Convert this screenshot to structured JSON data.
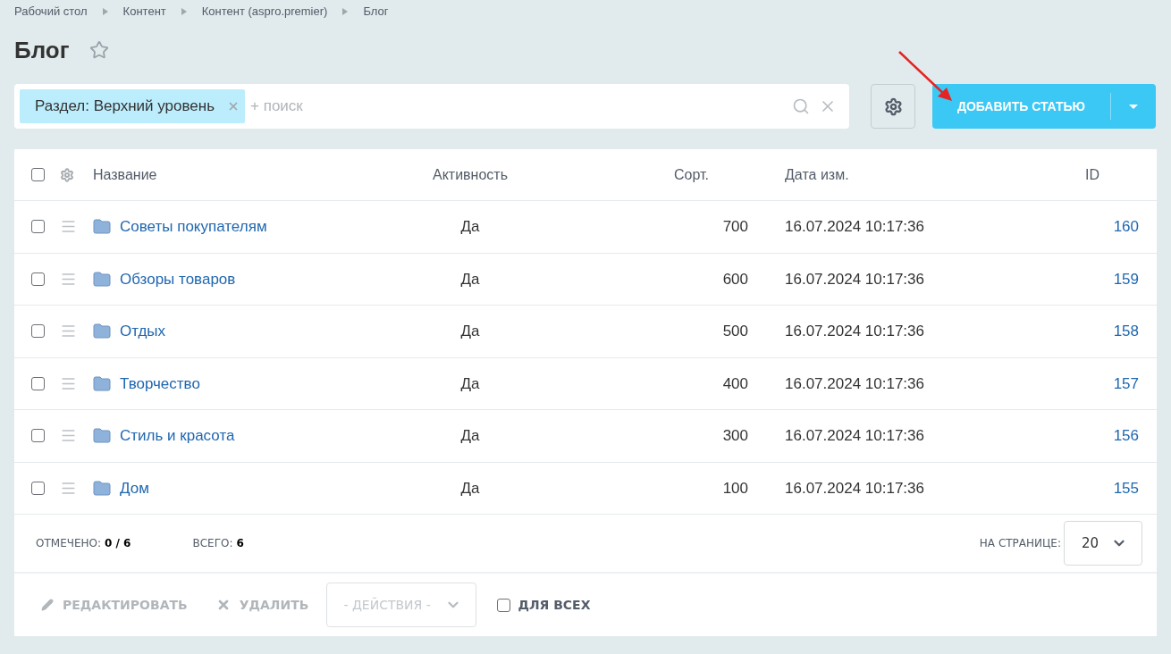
{
  "breadcrumbs": [
    "Рабочий стол",
    "Контент",
    "Контент (aspro.premier)",
    "Блог"
  ],
  "title": "Блог",
  "filter": {
    "tag": "Раздел: Верхний уровень",
    "placeholder": "+ поиск"
  },
  "add_button": {
    "label": "ДОБАВИТЬ СТАТЬЮ"
  },
  "table": {
    "select_all_checked": false,
    "columns": [
      "Название",
      "Активность",
      "Сорт.",
      "Дата изм.",
      "ID"
    ],
    "rows": [
      {
        "checked": false,
        "name": "Советы покупателям",
        "active": "Да",
        "sort": "700",
        "date": "16.07.2024 10:17:36",
        "id": "160"
      },
      {
        "checked": false,
        "name": "Обзоры товаров",
        "active": "Да",
        "sort": "600",
        "date": "16.07.2024 10:17:36",
        "id": "159"
      },
      {
        "checked": false,
        "name": "Отдых",
        "active": "Да",
        "sort": "500",
        "date": "16.07.2024 10:17:36",
        "id": "158"
      },
      {
        "checked": false,
        "name": "Творчество",
        "active": "Да",
        "sort": "400",
        "date": "16.07.2024 10:17:36",
        "id": "157"
      },
      {
        "checked": false,
        "name": "Стиль и красота",
        "active": "Да",
        "sort": "300",
        "date": "16.07.2024 10:17:36",
        "id": "156"
      },
      {
        "checked": false,
        "name": "Дом",
        "active": "Да",
        "sort": "100",
        "date": "16.07.2024 10:17:36",
        "id": "155"
      }
    ]
  },
  "footer": {
    "selected_label": "ОТМЕЧЕНО:",
    "selected_value": "0 / 6",
    "total_label": "ВСЕГО:",
    "total_value": "6",
    "per_page_label": "НА СТРАНИЦЕ:",
    "per_page_value": "20"
  },
  "actions": {
    "edit": "РЕДАКТИРОВАТЬ",
    "delete": "УДАЛИТЬ",
    "dropdown": "- ДЕЙСТВИЯ -",
    "for_all": {
      "label": "ДЛЯ ВСЕХ",
      "checked": false
    }
  }
}
